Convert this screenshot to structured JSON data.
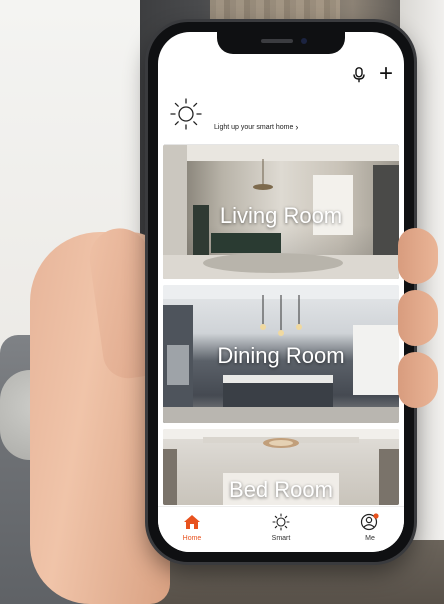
{
  "header": {
    "icons": [
      "microphone-icon",
      "plus-icon"
    ],
    "plus_glyph": "+"
  },
  "banner": {
    "icon": "sun-icon",
    "text": "Light up your smart home"
  },
  "rooms": [
    {
      "label": "Living Room"
    },
    {
      "label": "Dining Room"
    },
    {
      "label": "Bed Room"
    }
  ],
  "tabbar": {
    "items": [
      {
        "label": "Home",
        "icon": "home-icon",
        "active": true
      },
      {
        "label": "Smart",
        "icon": "sun-icon",
        "active": false
      },
      {
        "label": "Me",
        "icon": "user-icon",
        "active": false
      }
    ]
  },
  "colors": {
    "accent": "#e8521e",
    "notification_dot": "#e8521e"
  }
}
